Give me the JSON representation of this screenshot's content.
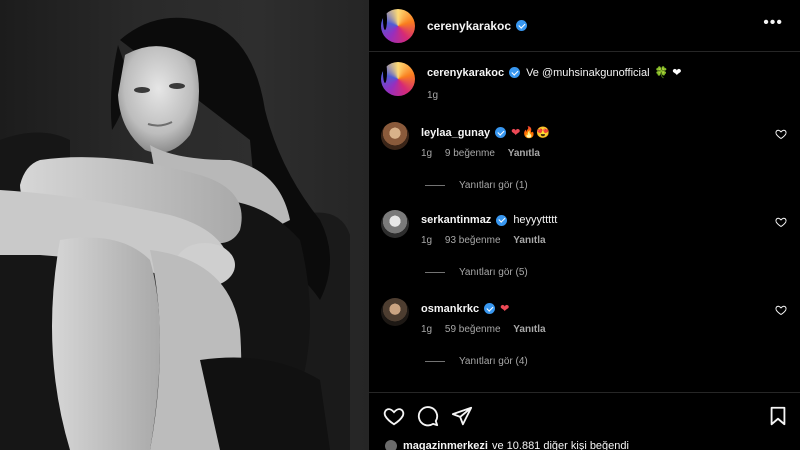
{
  "post": {
    "author": "cerenykarakoc",
    "more_icon": "more-horizontal-icon",
    "caption": {
      "author": "cerenykarakoc",
      "text": "Ve @muhsinakgunofficial",
      "emoji_1": "🍀",
      "emoji_2": "❤",
      "time": "1g"
    },
    "comments": [
      {
        "user": "leylaa_gunay",
        "text": "",
        "emoji_heart": "❤",
        "emoji_rest": "🔥😍",
        "time": "1g",
        "likes": "9 beğenme",
        "reply": "Yanıtla",
        "view_replies": "Yanıtları gör (1)"
      },
      {
        "user": "serkantinmaz",
        "text": "heyyyttttt",
        "emoji_heart": "",
        "emoji_rest": "",
        "time": "1g",
        "likes": "93 beğenme",
        "reply": "Yanıtla",
        "view_replies": "Yanıtları gör (5)"
      },
      {
        "user": "osmankrkc",
        "text": "",
        "emoji_heart": "❤",
        "emoji_rest": "",
        "time": "1g",
        "likes": "59 beğenme",
        "reply": "Yanıtla",
        "view_replies": "Yanıtları gör (4)"
      }
    ],
    "actions": {
      "like_icon": "heart-outline-icon",
      "comment_icon": "comment-bubble-icon",
      "share_icon": "paper-plane-icon",
      "save_icon": "bookmark-icon"
    },
    "liked_by": {
      "user": "magazinmerkezi",
      "rest": "ve 10.881 diğer kişi beğendi"
    }
  },
  "colors": {
    "background": "#000000",
    "text": "#f5f5f5",
    "muted": "#a8a8a8",
    "verified": "#3897f0",
    "heart_red": "#ed4956"
  }
}
